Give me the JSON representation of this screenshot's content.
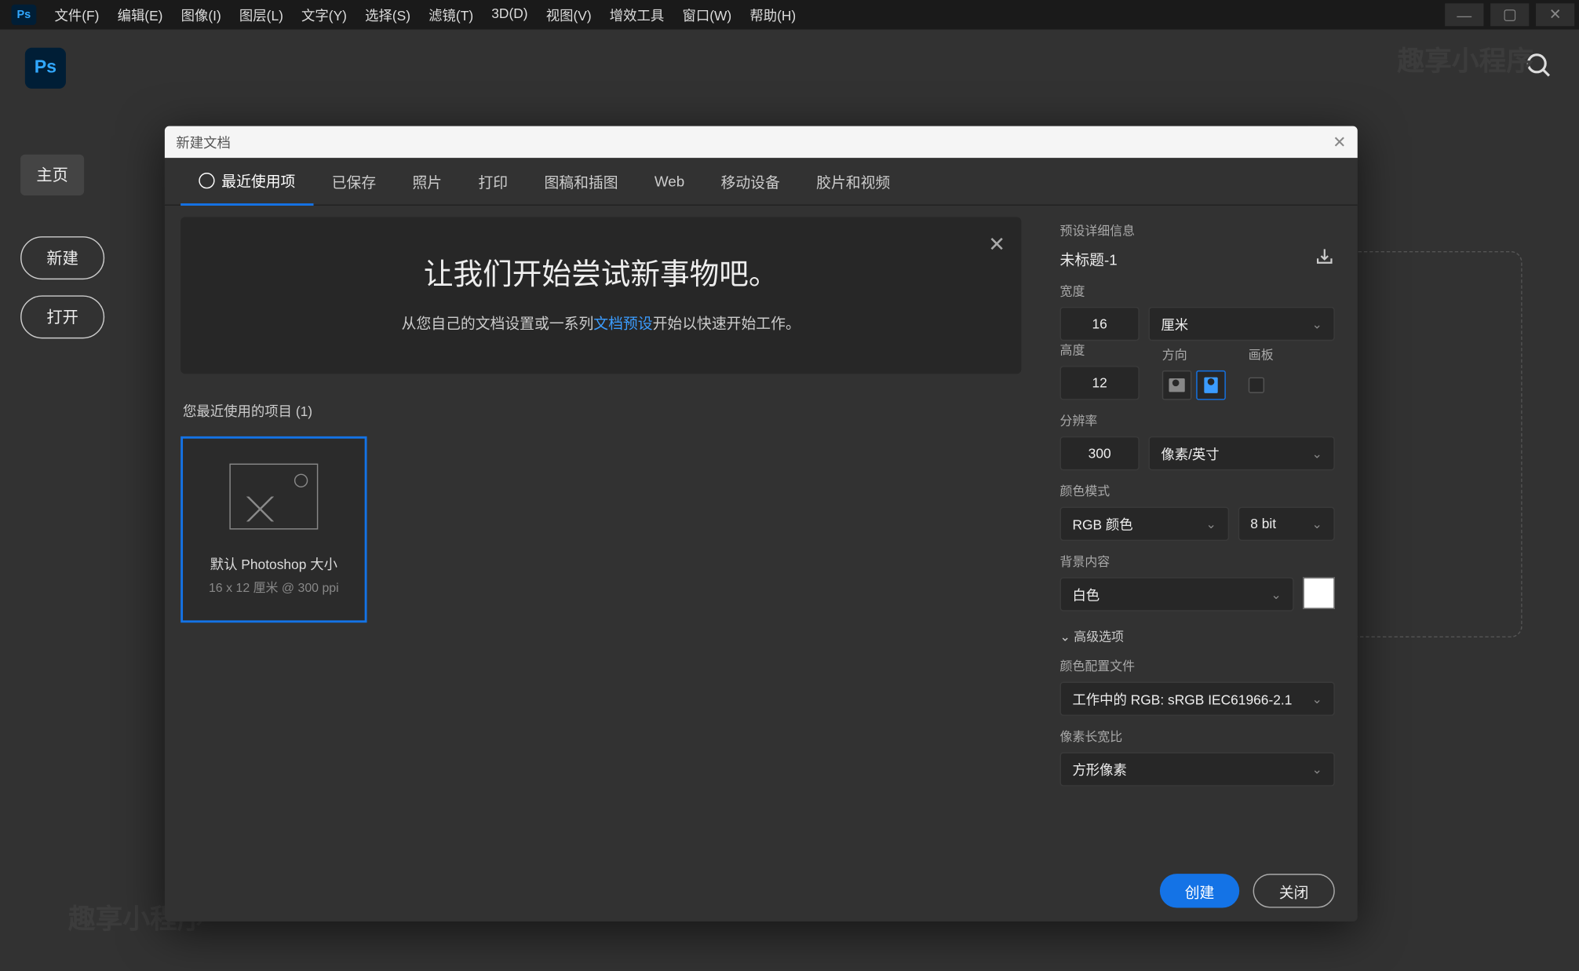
{
  "menubar": [
    "文件(F)",
    "编辑(E)",
    "图像(I)",
    "图层(L)",
    "文字(Y)",
    "选择(S)",
    "滤镜(T)",
    "3D(D)",
    "视图(V)",
    "增效工具",
    "窗口(W)",
    "帮助(H)"
  ],
  "app_logo": "Ps",
  "home": {
    "tab": "主页",
    "new_btn": "新建",
    "open_btn": "打开"
  },
  "watermark": "趣享小程序",
  "modal": {
    "title": "新建文档",
    "tabs": [
      "最近使用项",
      "已保存",
      "照片",
      "打印",
      "图稿和插图",
      "Web",
      "移动设备",
      "胶片和视频"
    ],
    "hero_title": "让我们开始尝试新事物吧。",
    "hero_sub_a": "从您自己的文档设置或一系列",
    "hero_link": "文档预设",
    "hero_sub_b": "开始以快速开始工作。",
    "recent_label": "您最近使用的项目 (1)",
    "preset": {
      "name": "默认 Photoshop 大小",
      "detail": "16 x 12 厘米 @ 300 ppi"
    },
    "panel": {
      "heading": "预设详细信息",
      "doc_title": "未标题-1",
      "width_label": "宽度",
      "width_value": "16",
      "width_unit": "厘米",
      "height_label": "高度",
      "height_value": "12",
      "orientation_label": "方向",
      "artboard_label": "画板",
      "resolution_label": "分辨率",
      "resolution_value": "300",
      "resolution_unit": "像素/英寸",
      "color_mode_label": "颜色模式",
      "color_mode_value": "RGB 颜色",
      "bit_depth": "8 bit",
      "bg_label": "背景内容",
      "bg_value": "白色",
      "advanced": "高级选项",
      "profile_label": "颜色配置文件",
      "profile_value": "工作中的 RGB: sRGB IEC61966-2.1",
      "aspect_label": "像素长宽比",
      "aspect_value": "方形像素"
    },
    "create_btn": "创建",
    "close_btn": "关闭"
  }
}
